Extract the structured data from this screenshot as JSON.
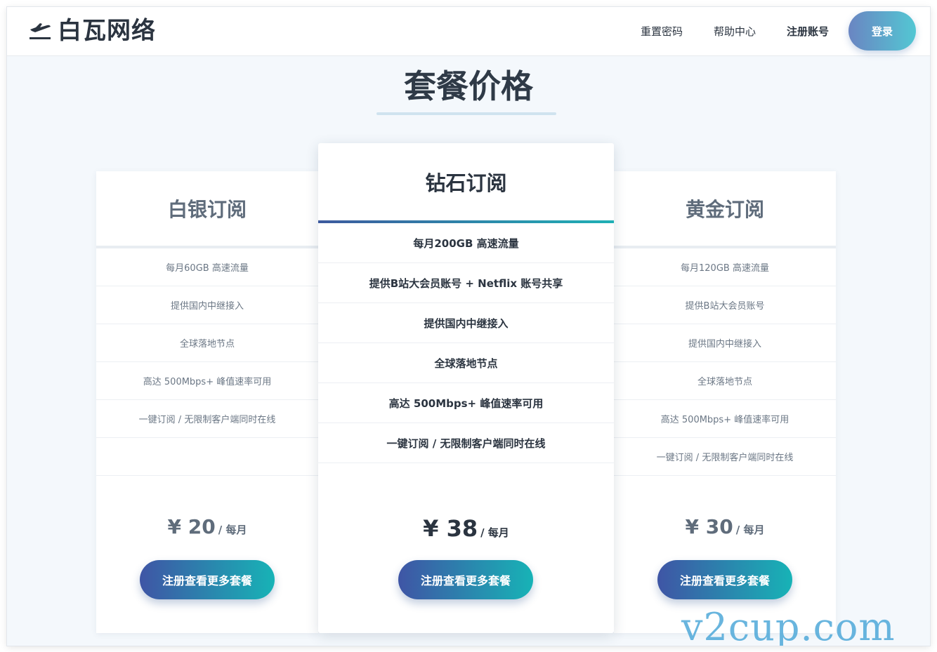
{
  "header": {
    "brand": "白瓦网络",
    "nav": [
      "重置密码",
      "帮助中心",
      "注册账号"
    ],
    "login": "登录"
  },
  "section_title": "套餐价格",
  "plans": [
    {
      "name": "白银订阅",
      "features": [
        "每月60GB 高速流量",
        "提供国内中继接入",
        "全球落地节点",
        "高达 500Mbps+ 峰值速率可用",
        "一键订阅 / 无限制客户端同时在线"
      ],
      "price": "¥ 20",
      "per": "/ 每月",
      "cta": "注册查看更多套餐"
    },
    {
      "name": "钻石订阅",
      "features": [
        "每月200GB 高速流量",
        "提供B站大会员账号 + Netflix 账号共享",
        "提供国内中继接入",
        "全球落地节点",
        "高达 500Mbps+ 峰值速率可用",
        "一键订阅 / 无限制客户端同时在线"
      ],
      "price": "¥ 38",
      "per": "/ 每月",
      "cta": "注册查看更多套餐"
    },
    {
      "name": "黄金订阅",
      "features": [
        "每月120GB 高速流量",
        "提供B站大会员账号",
        "提供国内中继接入",
        "全球落地节点",
        "高达 500Mbps+ 峰值速率可用",
        "一键订阅 / 无限制客户端同时在线"
      ],
      "price": "¥ 30",
      "per": "/ 每月",
      "cta": "注册查看更多套餐"
    }
  ],
  "watermark": "v2cup.com",
  "icons": {
    "brand": "airplane-departure-icon"
  },
  "colors": {
    "cta_start": "#3f55a5",
    "cta_end": "#17b3b6",
    "login_start": "#6a85c2",
    "login_end": "#53c7d3"
  }
}
